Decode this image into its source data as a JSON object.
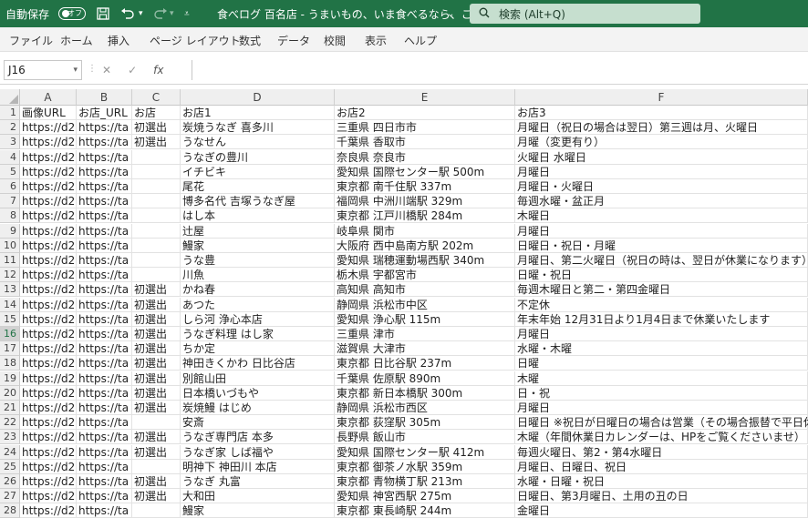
{
  "titlebar": {
    "autosave_label": "自動保存",
    "autosave_state": "オフ",
    "file_title": "食べログ 百名店 - うまいもの、いま食べるなら、このお店。.xlsx",
    "search_label": "検索 (Alt+Q)",
    "bg_color": "#217346"
  },
  "ribbon": {
    "tabs": [
      "ファイル",
      "ホーム",
      "挿入",
      "ページ レイアウト",
      "数式",
      "データ",
      "校閲",
      "表示",
      "ヘルプ"
    ]
  },
  "formula_bar": {
    "name_box": "J16",
    "fx_label": "fx",
    "formula": ""
  },
  "columns": [
    "A",
    "B",
    "C",
    "D",
    "E",
    "F"
  ],
  "selected_row": 16,
  "rows": [
    [
      "画像URL",
      "お店_URL",
      "お店",
      "お店1",
      "お店2",
      "お店3"
    ],
    [
      "https://d2",
      "https://ta",
      "初選出",
      "炭焼うなぎ 喜多川",
      "三重県 四日市市",
      "月曜日（祝日の場合は翌日）第三週は月、火曜日"
    ],
    [
      "https://d2",
      "https://ta",
      "初選出",
      "うなせん",
      "千葉県 香取市",
      "月曜（変更有り）"
    ],
    [
      "https://d2",
      "https://ta",
      "",
      "うなぎの豊川",
      "奈良県 奈良市",
      "火曜日 水曜日"
    ],
    [
      "https://d2",
      "https://ta",
      "",
      "イチビキ",
      "愛知県 国際センター駅 500m",
      "月曜日"
    ],
    [
      "https://d2",
      "https://ta",
      "",
      "尾花",
      "東京都 南千住駅 337m",
      "月曜日・火曜日"
    ],
    [
      "https://d2",
      "https://ta",
      "",
      "博多名代 吉塚うなぎ屋",
      "福岡県 中洲川端駅 329m",
      "毎週水曜・盆正月"
    ],
    [
      "https://d2",
      "https://ta",
      "",
      "はし本",
      "東京都 江戸川橋駅 284m",
      "木曜日"
    ],
    [
      "https://d2",
      "https://ta",
      "",
      "辻屋",
      "岐阜県 関市",
      "月曜日"
    ],
    [
      "https://d2",
      "https://ta",
      "",
      "鰻家",
      "大阪府 西中島南方駅 202m",
      "日曜日・祝日・月曜"
    ],
    [
      "https://d2",
      "https://ta",
      "",
      "うな豊",
      "愛知県 瑞穂運動場西駅 340m",
      "月曜日、第二火曜日（祝日の時は、翌日が休業になります）"
    ],
    [
      "https://d2",
      "https://ta",
      "",
      "川魚",
      "栃木県 宇都宮市",
      "日曜・祝日"
    ],
    [
      "https://d2",
      "https://ta",
      "初選出",
      "かね春",
      "高知県 高知市",
      "毎週木曜日と第二・第四金曜日"
    ],
    [
      "https://d2",
      "https://ta",
      "初選出",
      "あつた",
      "静岡県 浜松市中区",
      "不定休"
    ],
    [
      "https://d2",
      "https://ta",
      "初選出",
      "しら河 浄心本店",
      "愛知県 浄心駅 115m",
      "年末年始 12月31日より1月4日まで休業いたします"
    ],
    [
      "https://d2",
      "https://ta",
      "初選出",
      "うなぎ料理 はし家",
      "三重県 津市",
      "月曜日"
    ],
    [
      "https://d2",
      "https://ta",
      "初選出",
      "ちか定",
      "滋賀県 大津市",
      "水曜・木曜"
    ],
    [
      "https://d2",
      "https://ta",
      "初選出",
      "神田きくかわ 日比谷店",
      "東京都 日比谷駅 237m",
      "日曜"
    ],
    [
      "https://d2",
      "https://ta",
      "初選出",
      "別館山田",
      "千葉県 佐原駅 890m",
      "木曜"
    ],
    [
      "https://d2",
      "https://ta",
      "初選出",
      "日本橋いづもや",
      "東京都 新日本橋駅 300m",
      "日・祝"
    ],
    [
      "https://d2",
      "https://ta",
      "初選出",
      "炭焼鰻 はじめ",
      "静岡県 浜松市西区",
      "月曜日"
    ],
    [
      "https://d2",
      "https://ta",
      "",
      "安斎",
      "東京都 荻窪駅 305m",
      "日曜日 ※祝日が日曜日の場合は営業（その場合振替で平日休業）"
    ],
    [
      "https://d2",
      "https://ta",
      "初選出",
      "うなぎ専門店 本多",
      "長野県 飯山市",
      "木曜（年間休業日カレンダーは、HPをご覧くださいませ）"
    ],
    [
      "https://d2",
      "https://ta",
      "初選出",
      "うなぎ家 しば福や",
      "愛知県 国際センター駅 412m",
      "毎週火曜日、第2・第4水曜日"
    ],
    [
      "https://d2",
      "https://ta",
      "",
      "明神下 神田川 本店",
      "東京都 御茶ノ水駅 359m",
      "月曜日、日曜日、祝日"
    ],
    [
      "https://d2",
      "https://ta",
      "初選出",
      "うなぎ 丸富",
      "東京都 青物横丁駅 213m",
      "水曜・日曜・祝日"
    ],
    [
      "https://d2",
      "https://ta",
      "初選出",
      "大和田",
      "愛知県 神宮西駅 275m",
      "日曜日、第3月曜日、土用の丑の日"
    ],
    [
      "https://d2",
      "https://ta",
      "",
      "鰻家",
      "東京都 東長崎駅 244m",
      "金曜日"
    ]
  ]
}
